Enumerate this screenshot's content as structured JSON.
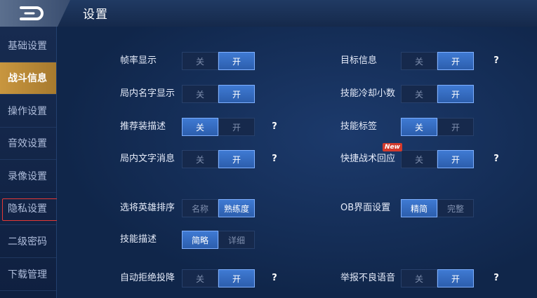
{
  "header": {
    "title": "设置",
    "back_icon": "back-arrow-icon"
  },
  "sidebar": {
    "items": [
      {
        "label": "基础设置"
      },
      {
        "label": "战斗信息",
        "active": true
      },
      {
        "label": "操作设置"
      },
      {
        "label": "音效设置"
      },
      {
        "label": "录像设置"
      },
      {
        "label": "隐私设置",
        "highlighted": true
      },
      {
        "label": "二级密码"
      },
      {
        "label": "下载管理"
      }
    ]
  },
  "settings": {
    "left": [
      {
        "label": "帧率显示",
        "options": [
          "关",
          "开"
        ],
        "selected": 1,
        "help": false
      },
      {
        "label": "局内名字显示",
        "options": [
          "关",
          "开"
        ],
        "selected": 1,
        "help": false
      },
      {
        "label": "推荐装描述",
        "options": [
          "关",
          "开"
        ],
        "selected": 0,
        "help": true
      },
      {
        "label": "局内文字消息",
        "options": [
          "关",
          "开"
        ],
        "selected": 1,
        "help": true
      },
      {
        "label": "选将英雄排序",
        "options": [
          "名称",
          "熟练度"
        ],
        "selected": 1,
        "help": false
      },
      {
        "label": "技能描述",
        "options": [
          "简略",
          "详细"
        ],
        "selected": 0,
        "help": false
      },
      {
        "label": "自动拒绝投降",
        "options": [
          "关",
          "开"
        ],
        "selected": 1,
        "help": true
      }
    ],
    "right": [
      {
        "label": "目标信息",
        "options": [
          "关",
          "开"
        ],
        "selected": 1,
        "help": true
      },
      {
        "label": "技能冷却小数",
        "options": [
          "关",
          "开"
        ],
        "selected": 1,
        "help": false
      },
      {
        "label": "技能标签",
        "options": [
          "关",
          "开"
        ],
        "selected": 0,
        "help": false
      },
      {
        "label": "快捷战术回应",
        "options": [
          "关",
          "开"
        ],
        "selected": 1,
        "help": true,
        "badge": "New"
      },
      {
        "label": "OB界面设置",
        "options": [
          "精简",
          "完整"
        ],
        "selected": 0,
        "help": false
      },
      {
        "label": "举报不良语音",
        "options": [
          "关",
          "开"
        ],
        "selected": 1,
        "help": true
      }
    ]
  },
  "help_symbol": "?",
  "colors": {
    "background": "#0f2347",
    "active_tab": "#c8963f",
    "toggle_on": "#3f7ad3",
    "highlight_box": "#e53935"
  }
}
